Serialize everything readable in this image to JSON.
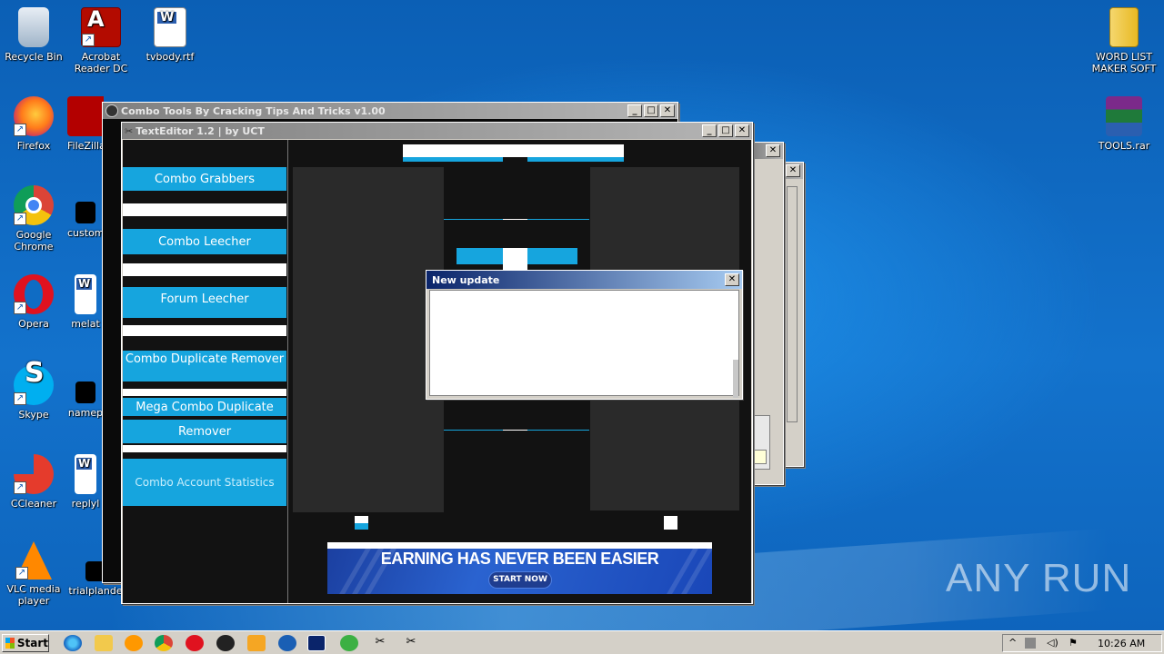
{
  "desktop_icons_left": [
    {
      "label": "Recycle Bin",
      "icon": "recycle-bin-icon"
    },
    {
      "label": "Acrobat Reader DC",
      "icon": "acrobat-icon"
    },
    {
      "label": "tvbody.rtf",
      "icon": "word-document-icon"
    },
    {
      "label": "Firefox",
      "icon": "firefox-icon"
    },
    {
      "label": "FileZilla",
      "icon": "filezilla-icon"
    },
    {
      "label": "Google Chrome",
      "icon": "chrome-icon"
    },
    {
      "label": "custom",
      "icon": "file-icon"
    },
    {
      "label": "Opera",
      "icon": "opera-icon"
    },
    {
      "label": "melat",
      "icon": "word-document-icon"
    },
    {
      "label": "Skype",
      "icon": "skype-icon"
    },
    {
      "label": "namep",
      "icon": "file-icon"
    },
    {
      "label": "CCleaner",
      "icon": "ccleaner-icon"
    },
    {
      "label": "replyl",
      "icon": "word-document-icon"
    },
    {
      "label": "VLC media player",
      "icon": "vlc-icon"
    },
    {
      "label": "trialplande",
      "icon": "file-icon"
    }
  ],
  "desktop_icons_right": [
    {
      "label": "WORD LIST MAKER SOFT",
      "icon": "folder-archive-icon"
    },
    {
      "label": "TOOLS.rar",
      "icon": "winrar-icon"
    }
  ],
  "windows": {
    "back": {
      "title": "Combo Tools By Cracking Tips And Tricks v1.00"
    },
    "front": {
      "title": "TextEditor 1.2  |  by UCT"
    }
  },
  "menu": [
    {
      "label": "Combo Grabbers"
    },
    {
      "label": "Combo Leecher"
    },
    {
      "label": "Forum Leecher"
    },
    {
      "label": "Combo Duplicate Remover"
    },
    {
      "label": "Mega Combo Duplicate"
    },
    {
      "label": "Remover"
    },
    {
      "label": "Combo Account Statistics"
    }
  ],
  "dialog": {
    "title": "New update"
  },
  "ad": {
    "headline": "EARNING HAS NEVER BEEN EASIER",
    "button": "START NOW"
  },
  "watermark": "ANY RUN",
  "taskbar": {
    "start_label": "Start",
    "clock": "10:26 AM"
  },
  "colors": {
    "accent_cyan": "#16a5de",
    "titlebar_active": "#0a246a",
    "desktop": "#0f6cc4"
  }
}
